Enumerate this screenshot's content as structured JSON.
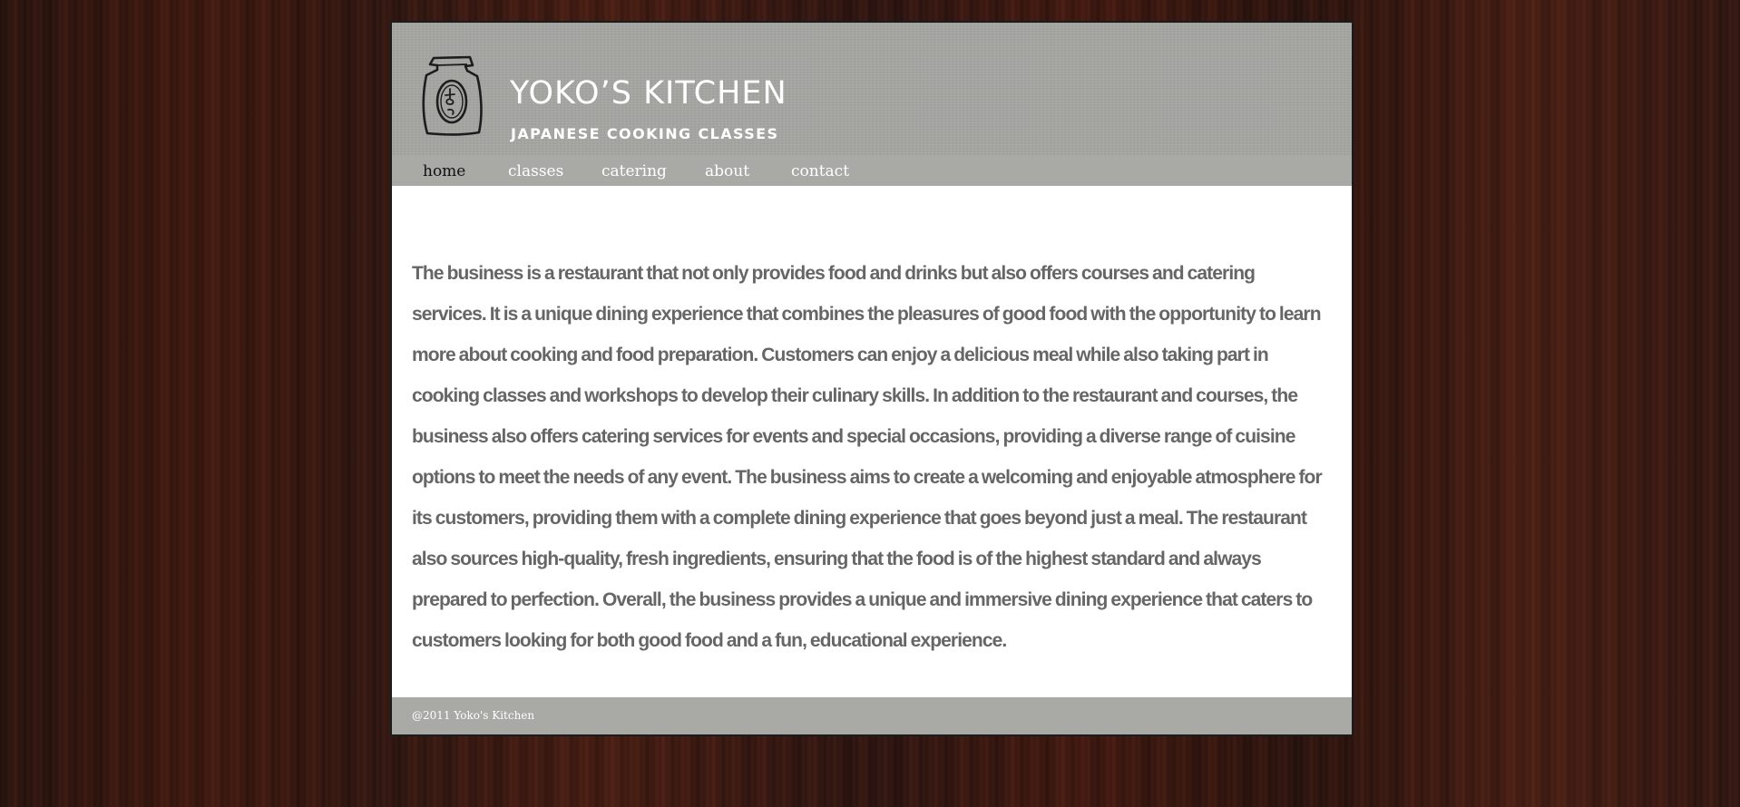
{
  "header": {
    "logo_icon": "yoko-bag-logo-icon",
    "title": "YOKO’S KITCHEN",
    "subtitle": "JAPANESE COOKING CLASSES"
  },
  "nav": {
    "items": [
      {
        "label": "home",
        "active": true
      },
      {
        "label": "classes",
        "active": false
      },
      {
        "label": "catering",
        "active": false
      },
      {
        "label": "about",
        "active": false
      },
      {
        "label": "contact",
        "active": false
      }
    ]
  },
  "main": {
    "paragraph": "The business is a restaurant that not only provides food and drinks but also offers courses and catering services. It is a unique dining experience that combines the pleasures of good food with the opportunity to learn more about cooking and food preparation. Customers can enjoy a delicious meal while also taking part in cooking classes and workshops to develop their culinary skills. In addition to the restaurant and courses, the business also offers catering services for events and special occasions, providing a diverse range of cuisine options to meet the needs of any event. The business aims to create a welcoming and enjoyable atmosphere for its customers, providing them with a complete dining experience that goes beyond just a meal. The restaurant also sources high-quality, fresh ingredients, ensuring that the food is of the highest standard and always prepared to perfection. Overall, the business provides a unique and immersive dining experience that caters to customers looking for both good food and a fun, educational experience."
  },
  "footer": {
    "copyright": "@2011 Yoko's Kitchen"
  },
  "colors": {
    "header_bg": "#a6a6a3",
    "nav_bg": "#a9a9a6",
    "body_text": "#666666",
    "active_nav": "#111111",
    "page_bg": "#3a1a12"
  }
}
